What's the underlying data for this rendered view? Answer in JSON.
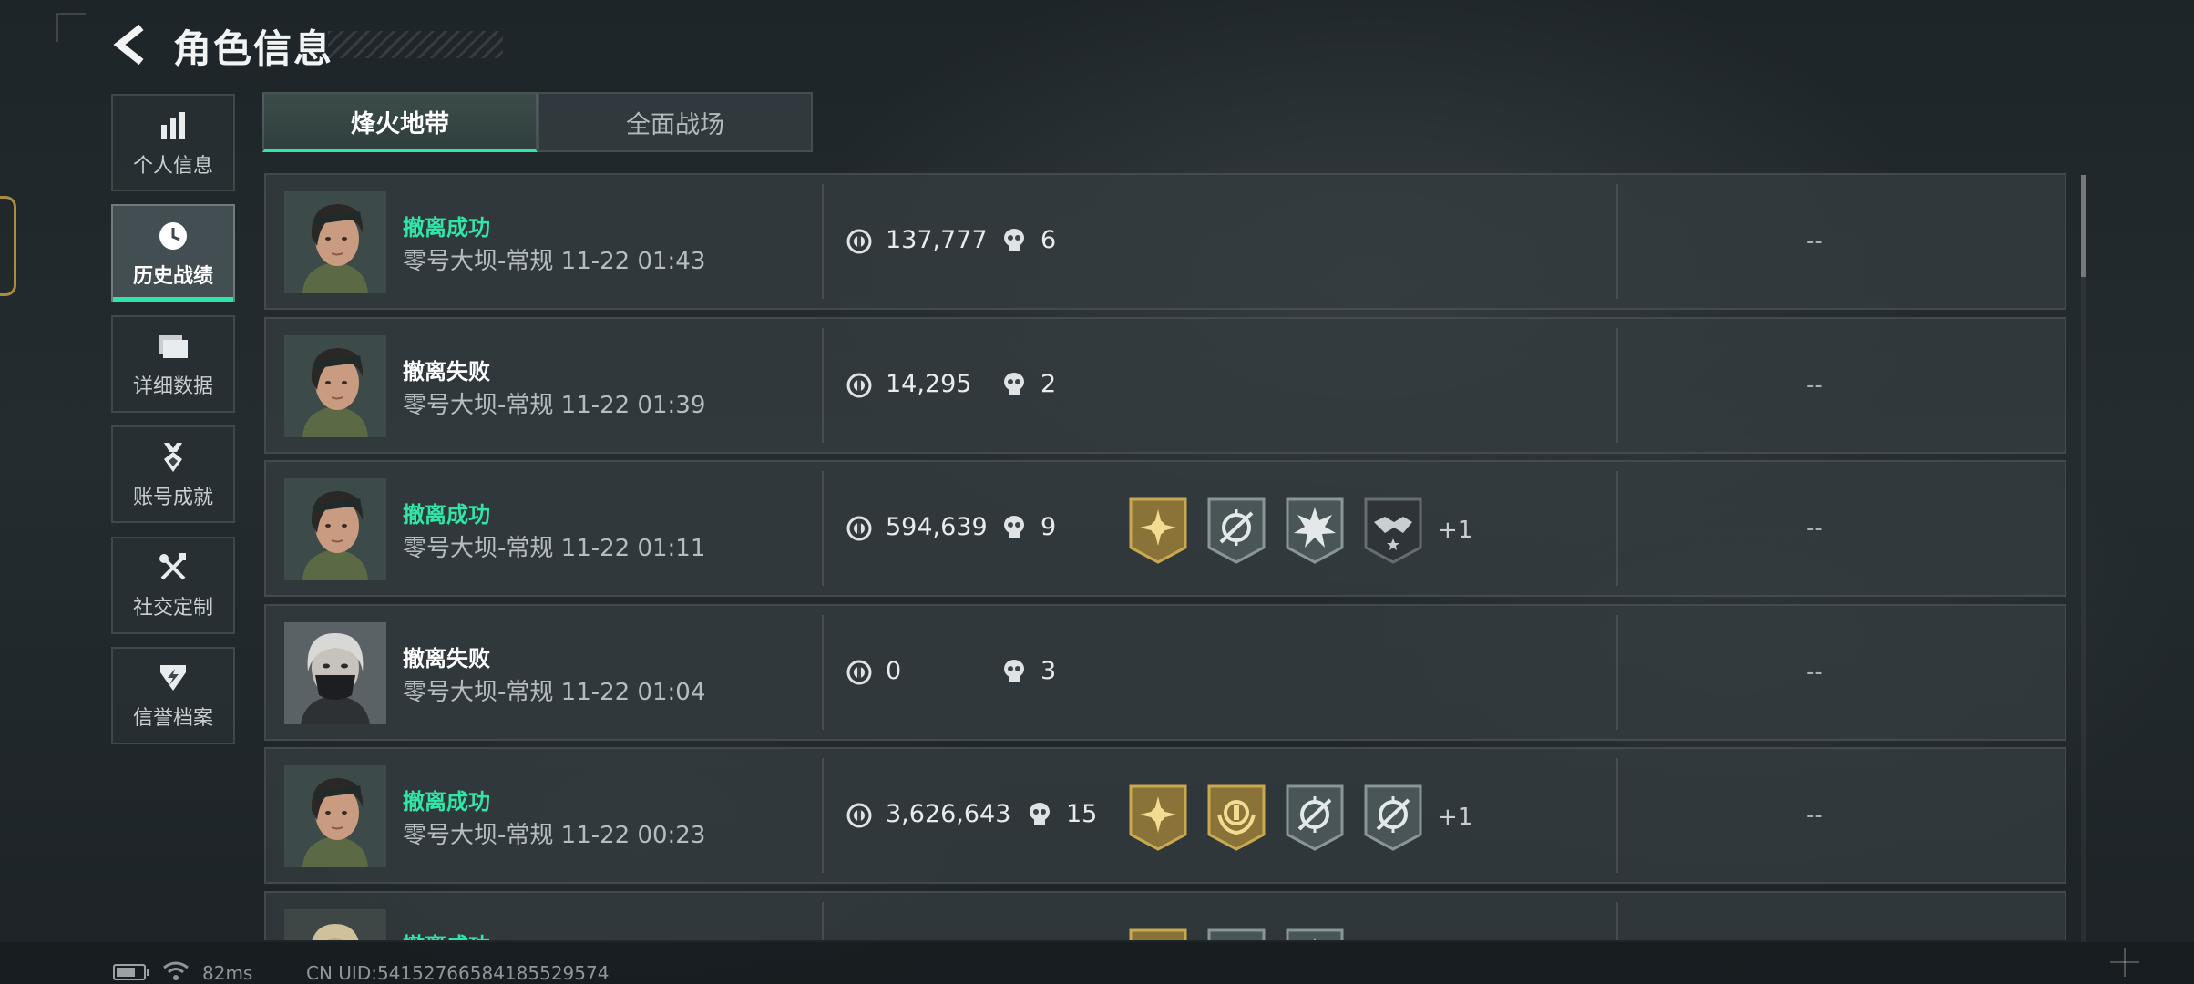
{
  "header": {
    "title": "角色信息"
  },
  "nav": {
    "items": [
      {
        "label": "个人信息",
        "icon": "bar-chart-icon",
        "active": false
      },
      {
        "label": "历史战绩",
        "icon": "clock-icon",
        "active": true
      },
      {
        "label": "详细数据",
        "icon": "folder-icon",
        "active": false
      },
      {
        "label": "账号成就",
        "icon": "medal-icon",
        "active": false
      },
      {
        "label": "社交定制",
        "icon": "tools-icon",
        "active": false
      },
      {
        "label": "信誉档案",
        "icon": "shield-bolt-icon",
        "active": false
      }
    ]
  },
  "tabs": [
    {
      "label": "烽火地带",
      "active": true
    },
    {
      "label": "全面战场",
      "active": false
    }
  ],
  "records": [
    {
      "result": "撤离成功",
      "success": true,
      "map": "零号大坝-常规 11-22 01:43",
      "coins": "137,777",
      "kills": "6",
      "badges": [],
      "extra": "",
      "rating": "--",
      "avatar": "operator-female"
    },
    {
      "result": "撤离失败",
      "success": false,
      "map": "零号大坝-常规 11-22 01:39",
      "coins": "14,295",
      "kills": "2",
      "badges": [],
      "extra": "",
      "rating": "--",
      "avatar": "operator-female"
    },
    {
      "result": "撤离成功",
      "success": true,
      "map": "零号大坝-常规 11-22 01:11",
      "coins": "594,639",
      "kills": "9",
      "badges": [
        "gold-sun-badge",
        "gray-crosshair-badge",
        "gray-burst-badge",
        "dark-handshake-badge"
      ],
      "extra": "+1",
      "rating": "--",
      "avatar": "operator-female"
    },
    {
      "result": "撤离失败",
      "success": false,
      "map": "零号大坝-常规 11-22 01:04",
      "coins": "0",
      "kills": "3",
      "badges": [],
      "extra": "",
      "rating": "--",
      "avatar": "operator-masked"
    },
    {
      "result": "撤离成功",
      "success": true,
      "map": "零号大坝-常规 11-22 00:23",
      "coins": "3,626,643",
      "kills": "15",
      "badges": [
        "gold-sun-badge",
        "gold-laurel-badge",
        "gray-crosshair-badge",
        "gray-crosshair-badge"
      ],
      "extra": "+1",
      "rating": "--",
      "avatar": "operator-female"
    },
    {
      "result": "撤离成功",
      "success": true,
      "map": "",
      "coins": "",
      "kills": "",
      "badges": [
        "gold-sun-badge",
        "gray-crosshair-badge",
        "gray-burst-badge"
      ],
      "extra": "",
      "rating": "",
      "avatar": "operator-blonde"
    }
  ],
  "status": {
    "ping": "82ms",
    "uid": "CN UID:54152766584185529574",
    "battery_level": 0.7
  },
  "colors": {
    "success": "#2fe6a6",
    "gold": "#b9993f",
    "panel": "#343c40"
  }
}
